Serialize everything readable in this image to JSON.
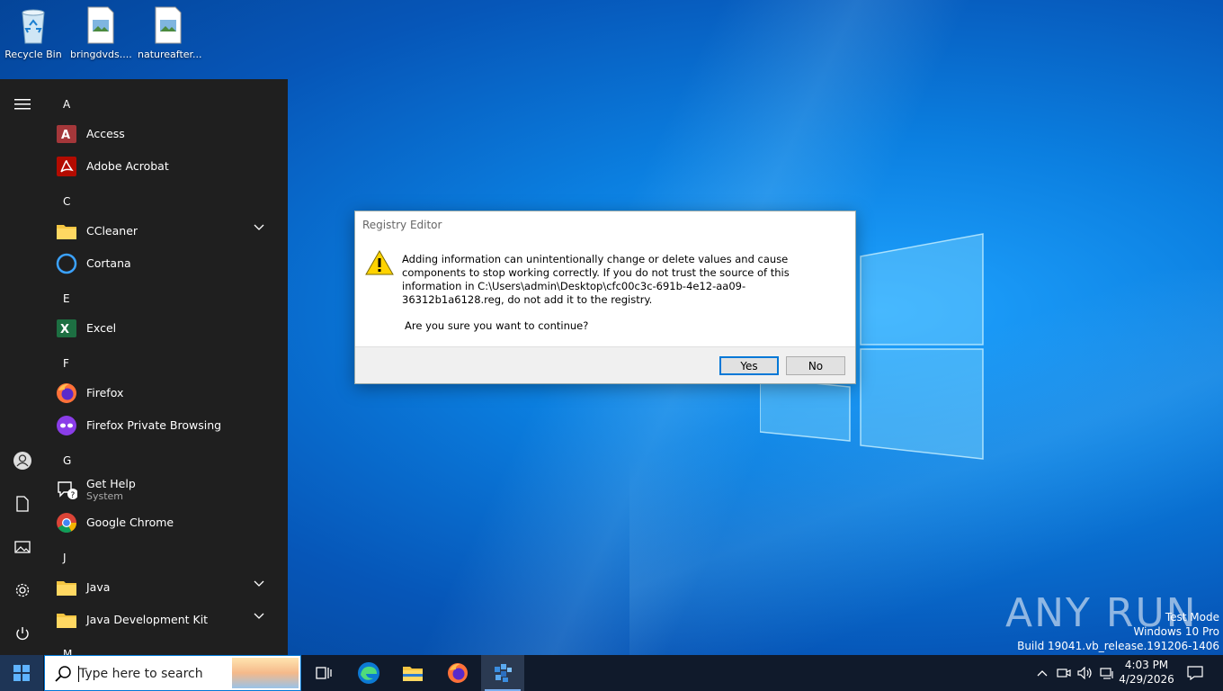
{
  "desktop": {
    "icons": [
      {
        "label": "Recycle Bin"
      },
      {
        "label": "bringdvds...."
      },
      {
        "label": "natureafter..."
      }
    ],
    "watermark": "ANY RUN",
    "test_mode": {
      "line1": "Test Mode",
      "line2": "Windows 10 Pro",
      "line3": "Build 19041.vb_release.191206-1406"
    }
  },
  "start_menu": {
    "rail": [
      "hamburger-icon",
      "user-icon",
      "documents-icon",
      "pictures-icon",
      "settings-icon",
      "power-icon"
    ],
    "groups": {
      "a": "A",
      "c": "C",
      "e": "E",
      "f": "F",
      "g": "G",
      "j": "J",
      "m": "M"
    },
    "apps": {
      "access": "Access",
      "acrobat": "Adobe Acrobat",
      "ccleaner": "CCleaner",
      "cortana": "Cortana",
      "excel": "Excel",
      "firefox": "Firefox",
      "firefox_private": "Firefox Private Browsing",
      "get_help": "Get Help",
      "get_help_sub": "System",
      "chrome": "Google Chrome",
      "java": "Java",
      "jdk": "Java Development Kit"
    }
  },
  "dialog": {
    "title": "Registry Editor",
    "message": "Adding information can unintentionally change or delete values and cause components to stop working correctly. If you do not trust the source of this information in C:\\Users\\admin\\Desktop\\cfc00c3c-691b-4e12-aa09-36312b1a6128.reg, do not add it to the registry.",
    "question": "Are you sure you want to continue?",
    "yes": "Yes",
    "no": "No"
  },
  "taskbar": {
    "search_placeholder": "Type here to search",
    "clock_time": "4:03 PM",
    "clock_date": "4/29/2026"
  },
  "colors": {
    "accent": "#0078d7",
    "start_bg": "#1f1f1f",
    "taskbar_bg": "#101a2b"
  }
}
